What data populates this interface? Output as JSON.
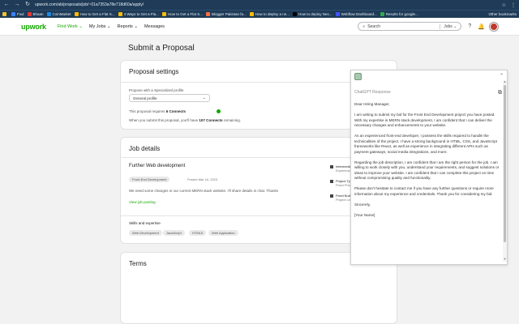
{
  "browser": {
    "nav": [
      "←",
      "→",
      "↻"
    ],
    "url": "upwork.com/ab/proposals/job/~01a7353a78e718d60a/apply/",
    "right_icons": [
      "☆",
      "⋮"
    ],
    "bookmarks": [
      {
        "label": "",
        "color": "#f2c230"
      },
      {
        "label": "Fixd",
        "color": "#3b82f6"
      },
      {
        "label": "Bhaan",
        "color": "#e53935"
      },
      {
        "label": "CoinMarket",
        "color": "#1e88e5"
      },
      {
        "label": "How to Get a Flat S...",
        "color": "#fbbc04"
      },
      {
        "label": "4 Ways to Get a Fla...",
        "color": "#fbbc04"
      },
      {
        "label": "How to Get a Flat S...",
        "color": "#fbbc04"
      },
      {
        "label": "Blogger Pakistan fa...",
        "color": "#ff7043"
      },
      {
        "label": "How to deploy a ne...",
        "color": "#fbbc04"
      },
      {
        "label": "How to deploy Nex...",
        "color": "#000000"
      },
      {
        "label": "Webflow Dashboard...",
        "color": "#4353ff"
      },
      {
        "label": "Results for google...",
        "color": "#34a853"
      }
    ],
    "other_bookmarks": "Other bookmarks"
  },
  "header": {
    "logo": "upwork",
    "nav": [
      "Find Work ⌄",
      "My Jobs ⌄",
      "Reports ⌄",
      "Messages"
    ],
    "search_placeholder": "Search",
    "search_scope": "Jobs ⌄",
    "icons": [
      "?",
      "🔔"
    ]
  },
  "page_title": "Submit a Proposal",
  "proposal_settings": {
    "heading": "Proposal settings",
    "specialized_label": "Propose with a Specialized profile",
    "profile_value": "General profile",
    "connects_prefix": "This proposal requires",
    "connects_count": "6 Connects",
    "remaining_text_1": "When you submit this proposal, you'll have",
    "remaining_count": "107 Connects",
    "remaining_text_2": "remaining."
  },
  "job_details": {
    "heading": "Job details",
    "title": "Further Web development",
    "category": "Front-End Development",
    "posted": "Posted Mar 16, 2023",
    "description": "We need some changes in our current MERN stack website. I'll share details in chat. Thanks",
    "view_posting": "View job posting",
    "side_features": [
      {
        "title": "Intermediate",
        "sub": "Experience level"
      },
      {
        "title": "Project Type",
        "sub": "Fixed Price"
      },
      {
        "title": "Fixed Budget",
        "sub": "Project Length"
      }
    ],
    "skills_heading": "Skills and expertise",
    "skills": [
      "Web Development",
      "JavaScript",
      "HTML5",
      "Web Application"
    ]
  },
  "terms": {
    "heading": "Terms"
  },
  "gpt_panel": {
    "title": "ChatGPT Response",
    "collapse": "⌃",
    "copy": "⧉",
    "paragraphs": [
      "Dear Hiring Manager,",
      "I am writing to submit my bid for the Front End Development project you have posted. With my expertise in MERN stack development, I am confident that I can deliver the necessary changes and enhancements to your website.",
      "As an experienced front-end developer, I possess the skills required to handle the technicalities of the project. I have a strong background in HTML, CSS, and JavaScript frameworks like React, as well as experience in integrating different APIs such as payment gateways, social media integrations, and more.",
      "Regarding the job description, I am confident that I am the right person for the job. I am willing to work closely with you, understand your requirements, and suggest solutions or ideas to improve your website. I am confident that I can complete this project on time without compromising quality and functionality.",
      "Please don't hesitate to contact me if you have any further questions or require more information about my experience and credentials. Thank you for considering my bid.",
      "Sincerely,",
      "[Your Name]"
    ]
  }
}
